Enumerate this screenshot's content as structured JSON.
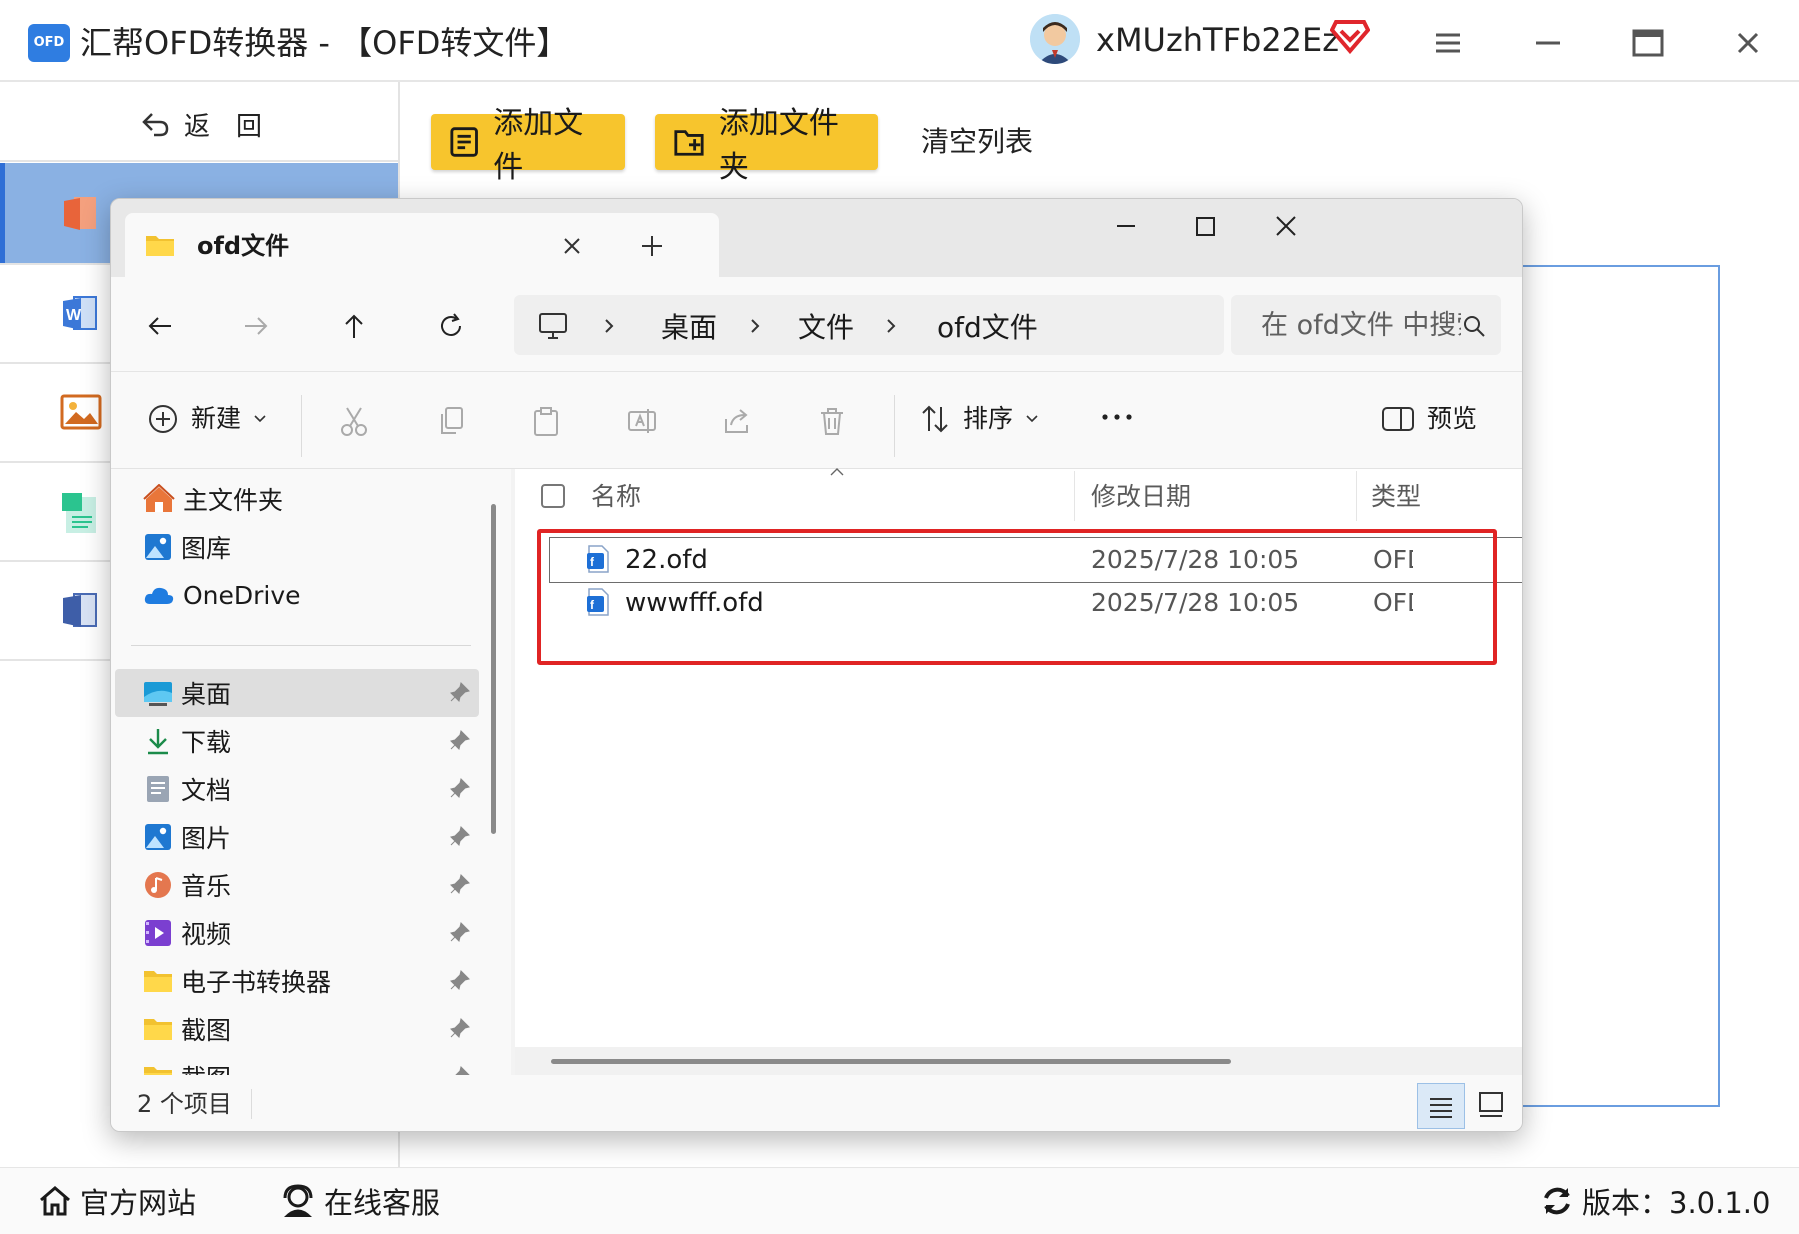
{
  "app": {
    "logo_text": "OFD",
    "title": "汇帮OFD转换器 - 【OFD转文件】",
    "username": "xMUzhTFb22Ez",
    "accent_color": "#f7c52d",
    "brand_blue": "#2f7de1"
  },
  "sidebar": {
    "back_label": "返　回",
    "items": [
      {
        "icon": "ofd-to-pdf-icon",
        "active": true
      },
      {
        "icon": "ofd-to-word-icon"
      },
      {
        "icon": "ofd-to-image-icon"
      },
      {
        "icon": "ofd-to-text-icon"
      },
      {
        "icon": "ofd-misc-icon"
      }
    ]
  },
  "toolbar": {
    "add_file": "添加文件",
    "add_folder": "添加文件夹",
    "clear_list": "清空列表"
  },
  "footer": {
    "website": "官方网站",
    "support": "在线客服",
    "version": "版本：3.0.1.0"
  },
  "explorer": {
    "tab_title": "ofd文件",
    "breadcrumb": [
      "桌面",
      "文件",
      "ofd文件"
    ],
    "search_placeholder": "在 ofd文件 中搜索",
    "commands": {
      "new": "新建",
      "sort": "排序",
      "preview": "预览",
      "more": "..."
    },
    "nav": {
      "top": [
        {
          "label": "主文件夹",
          "icon": "home-icon"
        },
        {
          "label": "图库",
          "icon": "gallery-icon"
        },
        {
          "label": "OneDrive",
          "icon": "cloud-icon"
        }
      ],
      "pinned": [
        {
          "label": "桌面",
          "icon": "desktop-icon",
          "selected": true
        },
        {
          "label": "下载",
          "icon": "download-icon"
        },
        {
          "label": "文档",
          "icon": "document-icon"
        },
        {
          "label": "图片",
          "icon": "pictures-icon"
        },
        {
          "label": "音乐",
          "icon": "music-icon"
        },
        {
          "label": "视频",
          "icon": "video-icon"
        },
        {
          "label": "电子书转换器",
          "icon": "folder-icon"
        },
        {
          "label": "截图",
          "icon": "folder-icon"
        },
        {
          "label": "截图",
          "icon": "folder-icon"
        }
      ]
    },
    "columns": {
      "name": "名称",
      "modified": "修改日期",
      "type": "类型"
    },
    "files": [
      {
        "name": "22.ofd",
        "modified": "2025/7/28 10:05",
        "type": "OFD"
      },
      {
        "name": "wwwfff.ofd",
        "modified": "2025/7/28 10:05",
        "type": "OFD"
      }
    ],
    "status": "2 个项目",
    "highlight_color": "#e02424"
  }
}
